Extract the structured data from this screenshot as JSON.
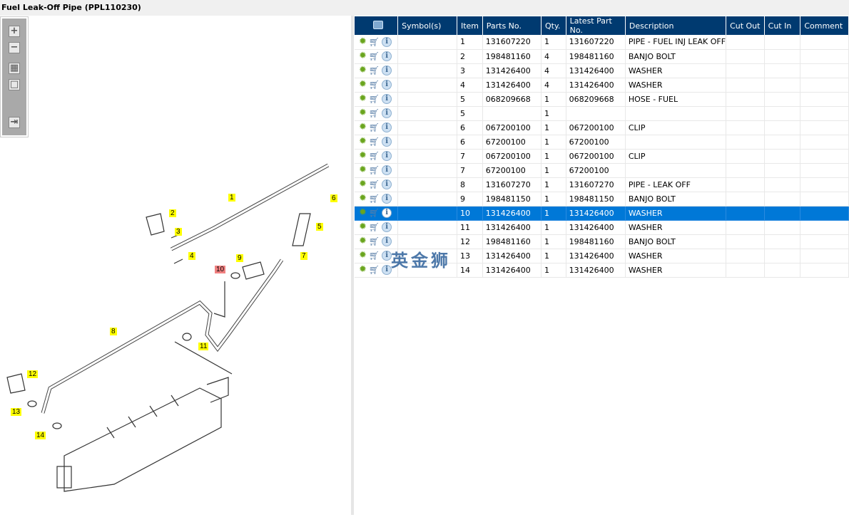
{
  "title": "Fuel Leak-Off Pipe (PPL110230)",
  "toolbar": [
    {
      "icon": "zoom-in-icon",
      "glyph": "+"
    },
    {
      "icon": "zoom-out-icon",
      "glyph": "−"
    },
    {
      "icon": "fit-all-icon",
      "glyph": "▦"
    },
    {
      "icon": "fit-window-icon",
      "glyph": "□"
    },
    {
      "icon": "export-icon",
      "glyph": "⇥"
    }
  ],
  "columns": [
    "",
    "Symbol(s)",
    "Item",
    "Parts No.",
    "Qty.",
    "Latest Part No.",
    "Description",
    "Cut Out",
    "Cut In",
    "Comment"
  ],
  "rows": [
    [
      "1",
      "131607220",
      "1",
      "131607220",
      "PIPE - FUEL INJ LEAK OFF"
    ],
    [
      "2",
      "198481160",
      "4",
      "198481160",
      "BANJO BOLT"
    ],
    [
      "3",
      "131426400",
      "4",
      "131426400",
      "WASHER"
    ],
    [
      "4",
      "131426400",
      "4",
      "131426400",
      "WASHER"
    ],
    [
      "5",
      "068209668",
      "1",
      "068209668",
      "HOSE - FUEL"
    ],
    [
      "5",
      "",
      "1",
      "",
      ""
    ],
    [
      "6",
      "067200100",
      "1",
      "067200100",
      "CLIP"
    ],
    [
      "6",
      "67200100",
      "1",
      "67200100",
      ""
    ],
    [
      "7",
      "067200100",
      "1",
      "067200100",
      "CLIP"
    ],
    [
      "7",
      "67200100",
      "1",
      "67200100",
      ""
    ],
    [
      "8",
      "131607270",
      "1",
      "131607270",
      "PIPE - LEAK OFF"
    ],
    [
      "9",
      "198481150",
      "1",
      "198481150",
      "BANJO BOLT"
    ],
    [
      "10",
      "131426400",
      "1",
      "131426400",
      "WASHER"
    ],
    [
      "11",
      "131426400",
      "1",
      "131426400",
      "WASHER"
    ],
    [
      "12",
      "198481160",
      "1",
      "198481160",
      "BANJO BOLT"
    ],
    [
      "13",
      "131426400",
      "1",
      "131426400",
      "WASHER"
    ],
    [
      "14",
      "131426400",
      "1",
      "131426400",
      "WASHER"
    ]
  ],
  "selected_item": "10",
  "callouts": [
    "1",
    "2",
    "3",
    "4",
    "5",
    "6",
    "7",
    "8",
    "9",
    "10",
    "11",
    "12",
    "13",
    "14"
  ],
  "highlighted_callout": "10",
  "watermark": "英金狮"
}
